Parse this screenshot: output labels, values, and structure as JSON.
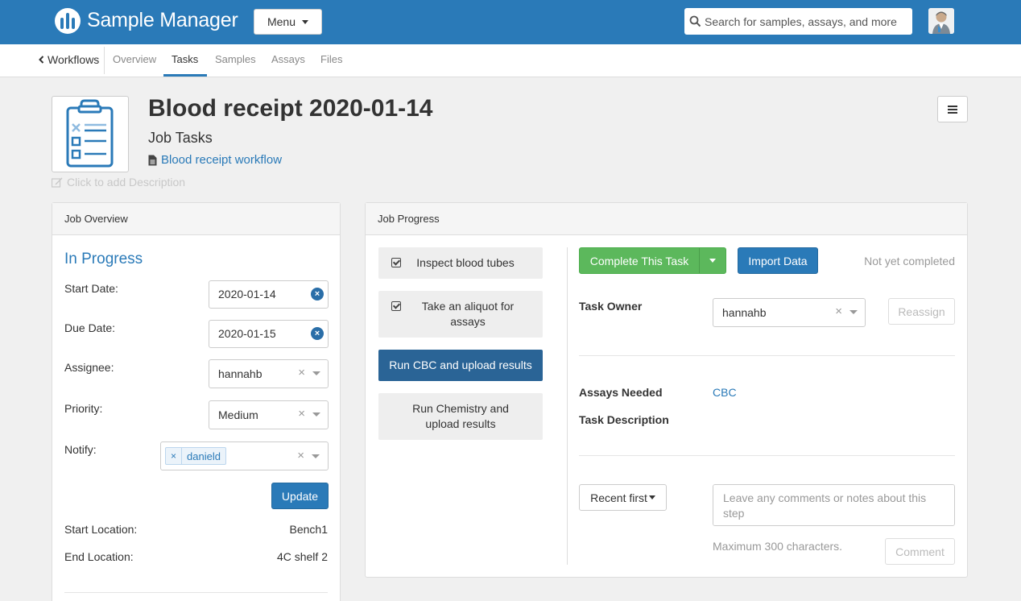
{
  "app": {
    "name": "Sample Manager",
    "menu_label": "Menu",
    "search_placeholder": "Search for samples, assays, and more"
  },
  "nav": {
    "back_label": "Workflows",
    "tabs": [
      {
        "label": "Overview",
        "active": false
      },
      {
        "label": "Tasks",
        "active": true
      },
      {
        "label": "Samples",
        "active": false
      },
      {
        "label": "Assays",
        "active": false
      },
      {
        "label": "Files",
        "active": false
      }
    ]
  },
  "page": {
    "title": "Blood receipt 2020-01-14",
    "subtitle": "Job Tasks",
    "workflow_link": "Blood receipt workflow",
    "description_placeholder": "Click to add Description"
  },
  "overview": {
    "heading": "Job Overview",
    "status": "In Progress",
    "start_date_label": "Start Date:",
    "start_date": "2020-01-14",
    "due_date_label": "Due Date:",
    "due_date": "2020-01-15",
    "assignee_label": "Assignee:",
    "assignee": "hannahb",
    "priority_label": "Priority:",
    "priority": "Medium",
    "notify_label": "Notify:",
    "notify_tags": [
      "danield"
    ],
    "update_button": "Update",
    "start_location_label": "Start Location:",
    "start_location": "Bench1",
    "end_location_label": "End Location:",
    "end_location": "4C shelf 2"
  },
  "progress": {
    "heading": "Job Progress",
    "steps": [
      {
        "label": "Inspect blood tubes",
        "completed": true,
        "active": false
      },
      {
        "label": "Take an aliquot for assays",
        "completed": true,
        "active": false
      },
      {
        "label": "Run CBC and upload results",
        "completed": false,
        "active": true
      },
      {
        "label": "Run Chemistry and upload results",
        "completed": false,
        "active": false
      }
    ],
    "complete_button": "Complete This Task",
    "import_button": "Import Data",
    "completion_status": "Not yet completed",
    "task_owner_label": "Task Owner",
    "task_owner": "hannahb",
    "reassign_button": "Reassign",
    "assays_needed_label": "Assays Needed",
    "assays_needed": "CBC",
    "task_description_label": "Task Description",
    "sort_label": "Recent first",
    "comment_placeholder": "Leave any comments or notes about this step",
    "comment_hint": "Maximum 300 characters.",
    "comment_button": "Comment"
  },
  "colors": {
    "brand": "#2a7ab8",
    "success": "#5cb85c",
    "active_step": "#2a6496"
  }
}
